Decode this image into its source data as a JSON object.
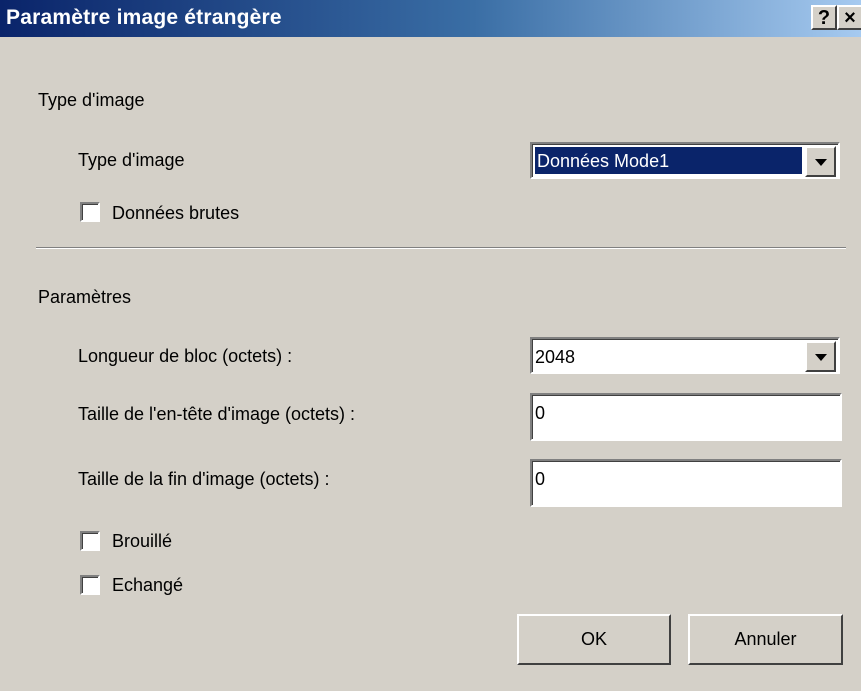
{
  "window": {
    "title": "Paramètre image étrangère",
    "help_label": "?",
    "close_label": "×"
  },
  "image_type_section": {
    "heading": "Type d'image",
    "type_label": "Type d'image",
    "type_value": "Données Mode1",
    "raw_data_label": "Données brutes",
    "raw_data_checked": false
  },
  "params_section": {
    "heading": "Paramètres",
    "block_length_label": "Longueur de bloc (octets) :",
    "block_length_value": "2048",
    "header_size_label": "Taille de l'en-tête d'image (octets) :",
    "header_size_value": "0",
    "footer_size_label": "Taille de la fin d'image (octets) :",
    "footer_size_value": "0",
    "scrambled_label": "Brouillé",
    "scrambled_checked": false,
    "swapped_label": "Echangé",
    "swapped_checked": false
  },
  "buttons": {
    "ok_label": "OK",
    "cancel_label": "Annuler"
  },
  "colors": {
    "titlebar_start": "#0a246a",
    "titlebar_end": "#a6caf0",
    "dialog_bg": "#d4d0c8",
    "selection": "#0a246a"
  }
}
